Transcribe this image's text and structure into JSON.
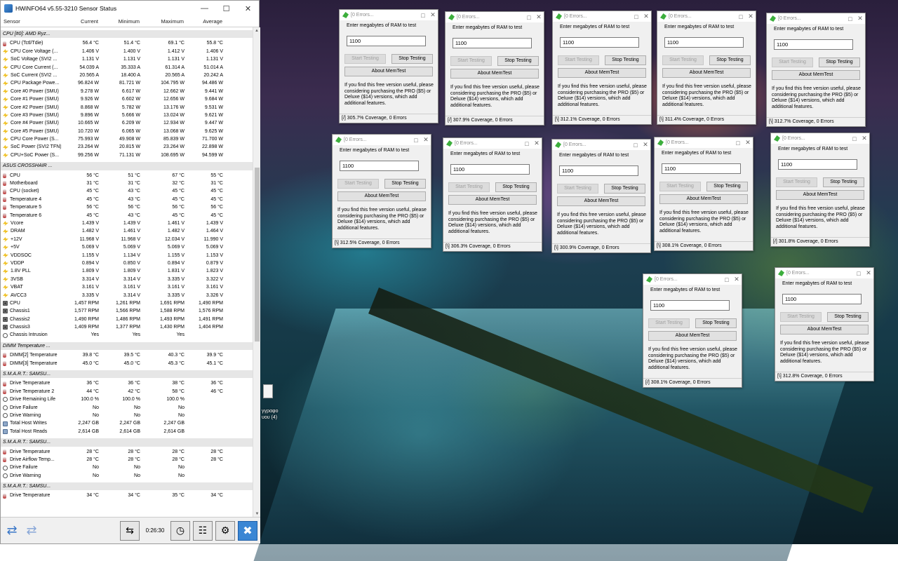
{
  "hwinfo": {
    "title": "HWiNFO64 v5.55-3210 Sensor Status",
    "columns": [
      "Sensor",
      "Current",
      "Minimum",
      "Maximum",
      "Average"
    ],
    "groups": [
      {
        "name": "CPU [#0]: AMD Ryz...",
        "rows": [
          {
            "icon": "temp",
            "name": "CPU (Tctl/Tdie)",
            "cur": "56.4 °C",
            "min": "51.4 °C",
            "max": "69.1 °C",
            "avg": "55.8 °C"
          },
          {
            "icon": "volt",
            "name": "CPU Core Voltage (...",
            "cur": "1.406 V",
            "min": "1.400 V",
            "max": "1.412 V",
            "avg": "1.406 V"
          },
          {
            "icon": "volt",
            "name": "SoC Voltage (SVI2 ...",
            "cur": "1.131 V",
            "min": "1.131 V",
            "max": "1.131 V",
            "avg": "1.131 V"
          },
          {
            "icon": "volt",
            "name": "CPU Core Current (...",
            "cur": "54.039 A",
            "min": "35.333 A",
            "max": "61.314 A",
            "avg": "51.014 A"
          },
          {
            "icon": "volt",
            "name": "SoC Current (SVI2 ...",
            "cur": "20.565 A",
            "min": "18.400 A",
            "max": "20.565 A",
            "avg": "20.242 A"
          },
          {
            "icon": "pow",
            "name": "CPU Package Powe...",
            "cur": "96.824 W",
            "min": "81.721 W",
            "max": "104.795 W",
            "avg": "94.486 W"
          },
          {
            "icon": "pow",
            "name": "Core #0 Power (SMU)",
            "cur": "9.278 W",
            "min": "6.617 W",
            "max": "12.662 W",
            "avg": "9.441 W"
          },
          {
            "icon": "pow",
            "name": "Core #1 Power (SMU)",
            "cur": "9.926 W",
            "min": "6.602 W",
            "max": "12.656 W",
            "avg": "9.684 W"
          },
          {
            "icon": "pow",
            "name": "Core #2 Power (SMU)",
            "cur": "8.868 W",
            "min": "5.782 W",
            "max": "13.176 W",
            "avg": "9.531 W"
          },
          {
            "icon": "pow",
            "name": "Core #3 Power (SMU)",
            "cur": "9.896 W",
            "min": "5.666 W",
            "max": "13.024 W",
            "avg": "9.621 W"
          },
          {
            "icon": "pow",
            "name": "Core #4 Power (SMU)",
            "cur": "10.665 W",
            "min": "6.209 W",
            "max": "12.934 W",
            "avg": "9.447 W"
          },
          {
            "icon": "pow",
            "name": "Core #5 Power (SMU)",
            "cur": "10.720 W",
            "min": "6.065 W",
            "max": "13.068 W",
            "avg": "9.625 W"
          },
          {
            "icon": "pow",
            "name": "CPU Core Power (S...",
            "cur": "75.993 W",
            "min": "49.908 W",
            "max": "85.839 W",
            "avg": "71.700 W"
          },
          {
            "icon": "pow",
            "name": "SoC Power (SVI2 TFN)",
            "cur": "23.264 W",
            "min": "20.815 W",
            "max": "23.264 W",
            "avg": "22.898 W"
          },
          {
            "icon": "pow",
            "name": "CPU+SoC Power (S...",
            "cur": "99.256 W",
            "min": "71.131 W",
            "max": "108.695 W",
            "avg": "94.599 W"
          }
        ]
      },
      {
        "name": "ASUS CROSSHAIR ...",
        "rows": [
          {
            "icon": "temp",
            "name": "CPU",
            "cur": "56 °C",
            "min": "51 °C",
            "max": "67 °C",
            "avg": "55 °C"
          },
          {
            "icon": "temp",
            "name": "Motherboard",
            "cur": "31 °C",
            "min": "31 °C",
            "max": "32 °C",
            "avg": "31 °C"
          },
          {
            "icon": "temp",
            "name": "CPU (socket)",
            "cur": "45 °C",
            "min": "43 °C",
            "max": "45 °C",
            "avg": "45 °C"
          },
          {
            "icon": "temp",
            "name": "Temperature 4",
            "cur": "45 °C",
            "min": "43 °C",
            "max": "45 °C",
            "avg": "45 °C"
          },
          {
            "icon": "temp",
            "name": "Temperature 5",
            "cur": "56 °C",
            "min": "56 °C",
            "max": "56 °C",
            "avg": "56 °C"
          },
          {
            "icon": "temp",
            "name": "Temperature 6",
            "cur": "45 °C",
            "min": "43 °C",
            "max": "45 °C",
            "avg": "45 °C"
          },
          {
            "icon": "volt",
            "name": "Vcore",
            "cur": "1.439 V",
            "min": "1.439 V",
            "max": "1.461 V",
            "avg": "1.439 V"
          },
          {
            "icon": "volt",
            "name": "DRAM",
            "cur": "1.482 V",
            "min": "1.461 V",
            "max": "1.482 V",
            "avg": "1.464 V"
          },
          {
            "icon": "volt",
            "name": "+12V",
            "cur": "11.968 V",
            "min": "11.968 V",
            "max": "12.034 V",
            "avg": "11.990 V"
          },
          {
            "icon": "volt",
            "name": "+5V",
            "cur": "5.069 V",
            "min": "5.069 V",
            "max": "5.069 V",
            "avg": "5.069 V"
          },
          {
            "icon": "volt",
            "name": "VDDSOC",
            "cur": "1.155 V",
            "min": "1.134 V",
            "max": "1.155 V",
            "avg": "1.153 V"
          },
          {
            "icon": "volt",
            "name": "VDDP",
            "cur": "0.894 V",
            "min": "0.850 V",
            "max": "0.894 V",
            "avg": "0.879 V"
          },
          {
            "icon": "volt",
            "name": "1.8V PLL",
            "cur": "1.809 V",
            "min": "1.809 V",
            "max": "1.831 V",
            "avg": "1.823 V"
          },
          {
            "icon": "volt",
            "name": "3VSB",
            "cur": "3.314 V",
            "min": "3.314 V",
            "max": "3.335 V",
            "avg": "3.322 V"
          },
          {
            "icon": "volt",
            "name": "VBAT",
            "cur": "3.161 V",
            "min": "3.161 V",
            "max": "3.161 V",
            "avg": "3.161 V"
          },
          {
            "icon": "volt",
            "name": "AVCC3",
            "cur": "3.335 V",
            "min": "3.314 V",
            "max": "3.335 V",
            "avg": "3.326 V"
          },
          {
            "icon": "fan",
            "name": "CPU",
            "cur": "1,457 RPM",
            "min": "1,261 RPM",
            "max": "1,691 RPM",
            "avg": "1,490 RPM"
          },
          {
            "icon": "fan",
            "name": "Chassis1",
            "cur": "1,577 RPM",
            "min": "1,566 RPM",
            "max": "1,588 RPM",
            "avg": "1,576 RPM"
          },
          {
            "icon": "fan",
            "name": "Chassis2",
            "cur": "1,490 RPM",
            "min": "1,486 RPM",
            "max": "1,493 RPM",
            "avg": "1,491 RPM"
          },
          {
            "icon": "fan",
            "name": "Chassis3",
            "cur": "1,409 RPM",
            "min": "1,377 RPM",
            "max": "1,430 RPM",
            "avg": "1,404 RPM"
          },
          {
            "icon": "clock",
            "name": "Chassis Intrusion",
            "cur": "Yes",
            "min": "Yes",
            "max": "Yes",
            "avg": ""
          }
        ]
      },
      {
        "name": "DIMM Temperature ...",
        "rows": [
          {
            "icon": "temp",
            "name": "DIMM[2] Temperature",
            "cur": "39.8 °C",
            "min": "39.5 °C",
            "max": "40.3 °C",
            "avg": "39.9 °C"
          },
          {
            "icon": "temp",
            "name": "DIMM[3] Temperature",
            "cur": "45.0 °C",
            "min": "45.0 °C",
            "max": "45.3 °C",
            "avg": "45.1 °C"
          }
        ]
      },
      {
        "name": "S.M.A.R.T.: SAMSU...",
        "rows": [
          {
            "icon": "temp",
            "name": "Drive Temperature",
            "cur": "36 °C",
            "min": "36 °C",
            "max": "38 °C",
            "avg": "36 °C"
          },
          {
            "icon": "temp",
            "name": "Drive Temperature 2",
            "cur": "44 °C",
            "min": "42 °C",
            "max": "58 °C",
            "avg": "46 °C"
          },
          {
            "icon": "clock",
            "name": "Drive Remaining Life",
            "cur": "100.0 %",
            "min": "100.0 %",
            "max": "100.0 %",
            "avg": ""
          },
          {
            "icon": "clock",
            "name": "Drive Failure",
            "cur": "No",
            "min": "No",
            "max": "No",
            "avg": ""
          },
          {
            "icon": "clock",
            "name": "Drive Warning",
            "cur": "No",
            "min": "No",
            "max": "No",
            "avg": ""
          },
          {
            "icon": "disk",
            "name": "Total Host Writes",
            "cur": "2,247 GB",
            "min": "2,247 GB",
            "max": "2,247 GB",
            "avg": ""
          },
          {
            "icon": "disk",
            "name": "Total Host Reads",
            "cur": "2,614 GB",
            "min": "2,614 GB",
            "max": "2,614 GB",
            "avg": ""
          }
        ]
      },
      {
        "name": "S.M.A.R.T.: SAMSU...",
        "rows": [
          {
            "icon": "temp",
            "name": "Drive Temperature",
            "cur": "28 °C",
            "min": "28 °C",
            "max": "28 °C",
            "avg": "28 °C"
          },
          {
            "icon": "temp",
            "name": "Drive Airflow Temp...",
            "cur": "28 °C",
            "min": "28 °C",
            "max": "28 °C",
            "avg": "28 °C"
          },
          {
            "icon": "clock",
            "name": "Drive Failure",
            "cur": "No",
            "min": "No",
            "max": "No",
            "avg": ""
          },
          {
            "icon": "clock",
            "name": "Drive Warning",
            "cur": "No",
            "min": "No",
            "max": "No",
            "avg": ""
          }
        ]
      },
      {
        "name": "S.M.A.R.T.: SAMSU...",
        "rows": [
          {
            "icon": "temp",
            "name": "Drive Temperature",
            "cur": "34 °C",
            "min": "34 °C",
            "max": "35 °C",
            "avg": "34 °C"
          }
        ]
      }
    ],
    "status": {
      "elapsed": "0:26:30"
    }
  },
  "desktop_file": {
    "label": "γγραφο\nυου (4)"
  },
  "memtest": {
    "title": "[0 Errors...",
    "prompt": "Enter megabytes of RAM to test",
    "value": "1100",
    "start_label": "Start Testing",
    "stop_label": "Stop Testing",
    "about_label": "About MemTest",
    "info": "If you find this free version useful, please considering purchasing the PRO ($5) or Deluxe ($14) versions, which add additional features.",
    "windows": [
      {
        "footer": "[/]   305.7% Coverage, 0 Errors"
      },
      {
        "footer": "[/]   307.9% Coverage, 0 Errors"
      },
      {
        "footer": "[\\]   312.1% Coverage, 0 Errors"
      },
      {
        "footer": "[\\]   311.4% Coverage, 0 Errors"
      },
      {
        "footer": "[\\]   312.7% Coverage, 0 Errors"
      },
      {
        "footer": "[\\]   312.5% Coverage, 0 Errors"
      },
      {
        "footer": "[\\]   306.3% Coverage, 0 Errors"
      },
      {
        "footer": "[\\]   300.9% Coverage, 0 Errors"
      },
      {
        "footer": "[\\]   308.1% Coverage, 0 Errors"
      },
      {
        "footer": "[/]   301.8% Coverage, 0 Errors"
      },
      {
        "footer": "[/]   308.1% Coverage, 0 Errors"
      },
      {
        "footer": "[\\]   312.8% Coverage, 0 Errors"
      }
    ]
  }
}
